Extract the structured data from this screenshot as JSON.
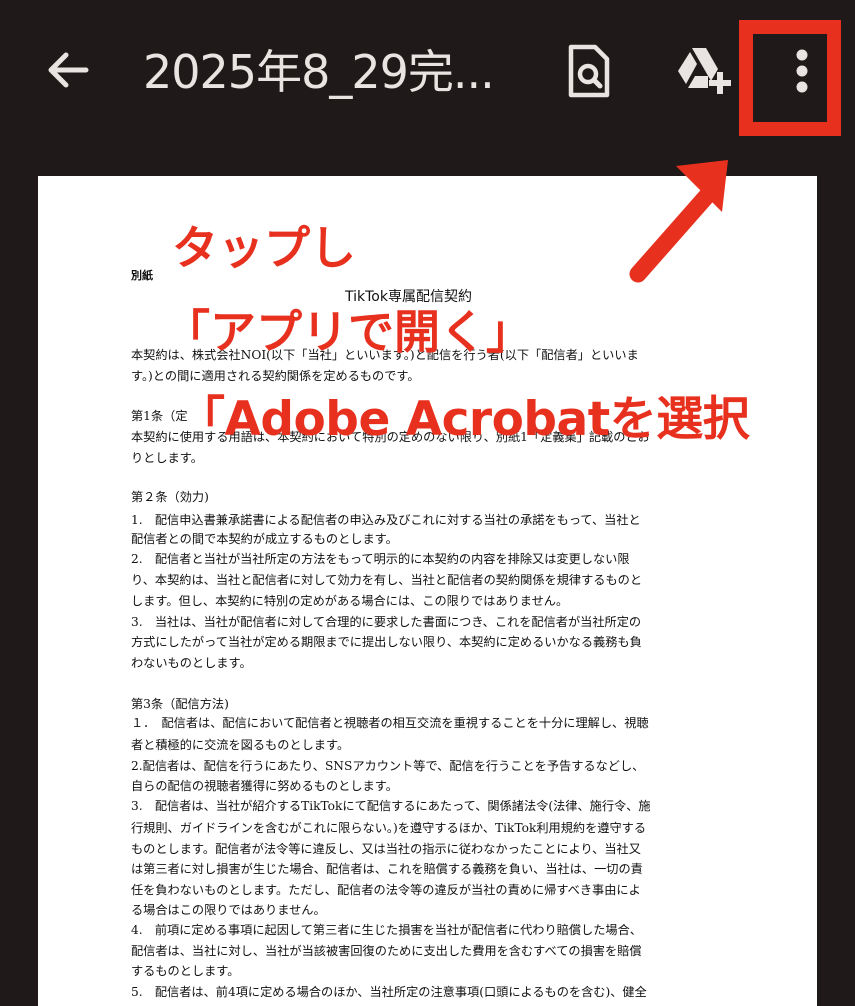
{
  "app_bar": {
    "title": "2025年8_29完..."
  },
  "document": {
    "title": "TikTok専属配信契約",
    "lines": [
      "別紙",
      "本契約は、株式会社NOI(以下「当社」といいます。)と配信を行う者(以下「配信者」といいま",
      "す。)との間に適用される契約関係を定めるものです。",
      "第1条（定",
      "本契約に使用する用語は、本契約において特別の定めのない限り、別紙1「定義集」記載のとお",
      "りとします。",
      "第２条（効力)",
      "1.　配信申込書兼承諾書による配信者の申込み及びこれに対する当社の承諾をもって、当社と",
      "配信者との間で本契約が成立するものとします。",
      "2.　配信者と当社が当社所定の方法をもって明示的に本契約の内容を排除又は変更しない限",
      "り、本契約は、当社と配信者に対して効力を有し、当社と配信者の契約関係を規律するものと",
      "します。但し、本契約に特別の定めがある場合には、この限りではありません。",
      "3.　当社は、当社が配信者に対して合理的に要求した書面につき、これを配信者が当社所定の",
      "方式にしたがって当社が定める期限までに提出しない限り、本契約に定めるいかなる義務も負",
      "わないものとします。",
      "第3条（配信方法)",
      "１．　配信者は、配信において配信者と視聴者の相互交流を重視することを十分に理解し、視聴",
      "者と積極的に交流を図るものとします。",
      "2.配信者は、配信を行うにあたり、SNSアカウント等で、配信を行うことを予告するなどし、",
      "自らの配信の視聴者獲得に努めるものとします。",
      "3.　配信者は、当社が紹介するTikTokにて配信するにあたって、関係諸法令(法律、施行令、施",
      "行規則、ガイドラインを含むがこれに限らない。)を遵守するほか、TikTok利用規約を遵守する",
      "ものとします。配信者が法令等に違反し、又は当社の指示に従わなかったことにより、当社又",
      "は第三者に対し損害が生じた場合、配信者は、これを賠償する義務を負い、当社は、一切の責",
      "任を負わないものとします。ただし、配信者の法令等の違反が当社の責めに帰すべき事由によ",
      "る場合はこの限りではありません。",
      "4.　前項に定める事項に起因して第三者に生じた損害を当社が配信者に代わり賠償した場合、",
      "配信者は、当社に対し、当社が当該被害回復のために支出した費用を含むすべての損害を賠償",
      "するものとします。",
      "5.　配信者は、前4項に定める場合のほか、当社所定の注意事項(口頭によるものを含む)、健全"
    ]
  },
  "annotation": {
    "line1": "タップし",
    "line2": "「アプリで開く」",
    "line3": "「Adobe Acrobatを選択",
    "color": "#e8301f"
  },
  "colors": {
    "background": "#1f1a19",
    "icon": "#e9e3e1",
    "accent": "#e8301f"
  },
  "icons": {
    "back": "arrow-left-icon",
    "find": "find-in-page-icon",
    "drive": "add-to-drive-icon",
    "more": "more-vert-icon"
  }
}
